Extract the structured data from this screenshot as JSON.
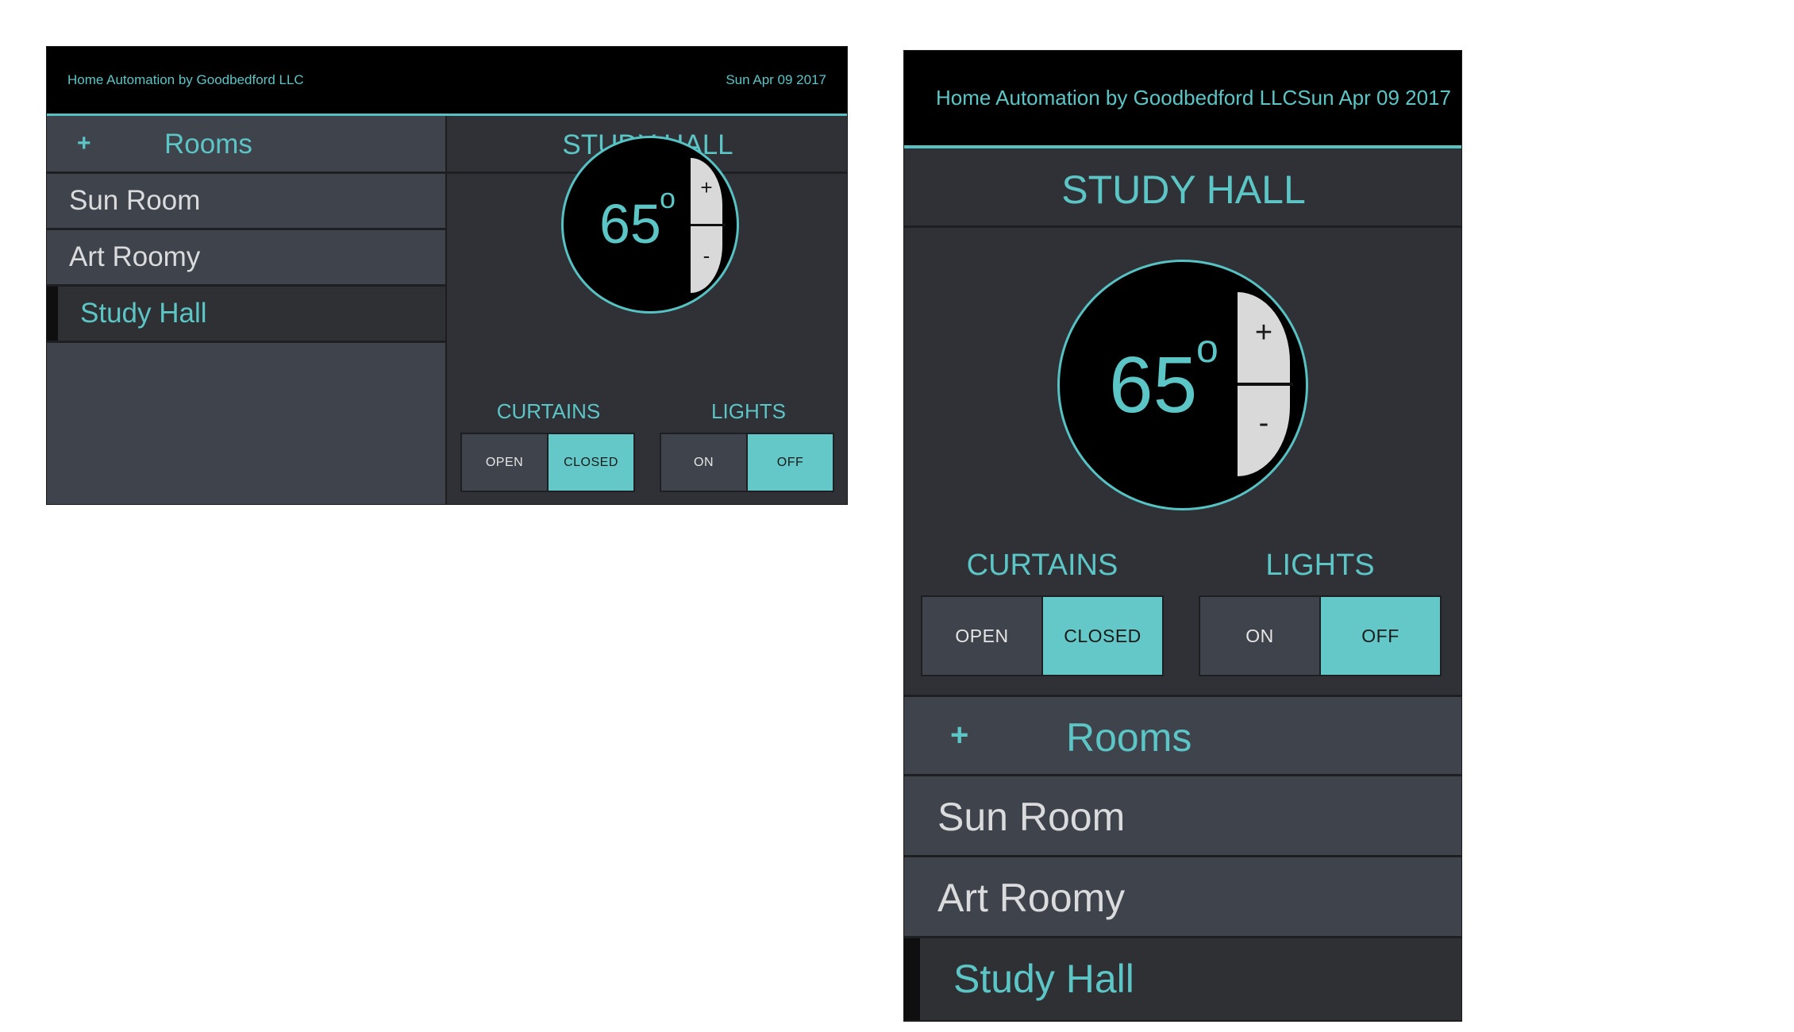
{
  "app": {
    "title": "Home Automation by Goodbedford LLC",
    "date": "Sun Apr 09 2017",
    "mobile_header": "Home Automation by Goodbedford LLCSun Apr 09 2017"
  },
  "sidebar": {
    "plus": "+",
    "heading": "Rooms",
    "items": [
      {
        "label": "Sun Room",
        "selected": false
      },
      {
        "label": "Art Roomy",
        "selected": false
      },
      {
        "label": "Study Hall",
        "selected": true
      }
    ]
  },
  "room": {
    "title": "STUDY HALL",
    "thermostat": {
      "temperature": "65",
      "degree": "o",
      "increase": "+",
      "decrease": "-"
    },
    "curtains": {
      "label": "CURTAINS",
      "options": [
        "OPEN",
        "CLOSED"
      ],
      "selected": "CLOSED"
    },
    "lights": {
      "label": "LIGHTS",
      "options": [
        "ON",
        "OFF"
      ],
      "selected": "OFF"
    }
  },
  "colors": {
    "accent": "#5cc5c6",
    "active_toggle": "#64c8c8",
    "sidebar_bg": "#3f434b",
    "panel_bg": "#2f3136",
    "header_bg": "#000000"
  }
}
